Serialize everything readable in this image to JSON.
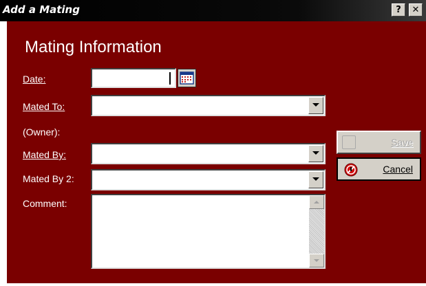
{
  "window": {
    "title": "Add a Mating",
    "help_label": "?",
    "close_label": "✕"
  },
  "form": {
    "heading": "Mating Information",
    "date_label": "Date:",
    "date_value": "",
    "mated_to_label": "Mated To:",
    "mated_to_value": "",
    "owner_label": "(Owner):",
    "mated_by_label": "Mated By:",
    "mated_by_value": "",
    "mated_by_2_label": "Mated By 2:",
    "mated_by_2_value": "",
    "comment_label": "Comment:",
    "comment_value": ""
  },
  "buttons": {
    "save_label": "Save",
    "cancel_label": "Cancel"
  },
  "colors": {
    "background": "#7a0000",
    "titlebar": "#000000",
    "button_face": "#d4d0c8"
  },
  "icons": {
    "calendar": "calendar-icon",
    "dropdown": "chevron-down-icon",
    "save": "save-icon",
    "cancel": "cancel-icon"
  }
}
